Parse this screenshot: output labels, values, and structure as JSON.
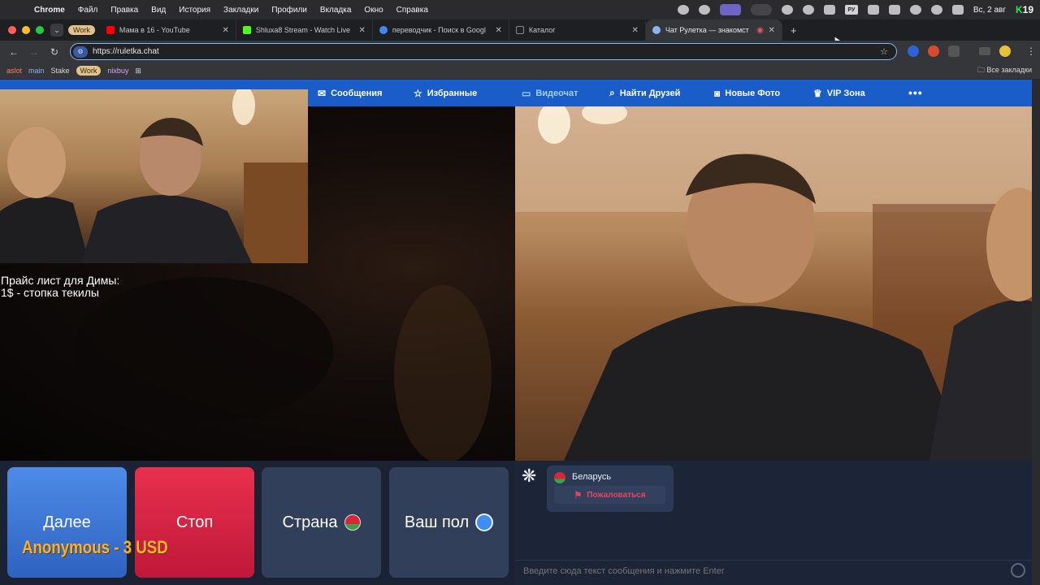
{
  "menubar": {
    "app": "Chrome",
    "items": [
      "Файл",
      "Правка",
      "Вид",
      "История",
      "Закладки",
      "Профили",
      "Вкладка",
      "Окно",
      "Справка"
    ],
    "lang": "РУ",
    "clock": "Вс, 2 авг",
    "badge": "K",
    "badge_num": "19"
  },
  "tabs": {
    "group_label": "Work",
    "items": [
      {
        "title": "Мама в 16 - YouTube",
        "icon": "youtube-icon",
        "color": "#ff0000"
      },
      {
        "title": "Shluxa8 Stream - Watch Live",
        "icon": "kick-icon",
        "color": "#53fc18"
      },
      {
        "title": "переводчик - Поиск в Googl",
        "icon": "google-icon",
        "color": "#4285f4"
      },
      {
        "title": "Каталог",
        "icon": "page-icon",
        "color": "#222222"
      },
      {
        "title": "Чат Рулетка — знакомст",
        "icon": "ruletka-icon",
        "color": "#8ab4f8"
      }
    ]
  },
  "address": {
    "url": "https://ruletka.chat"
  },
  "bookmarks": {
    "items": [
      {
        "label": "aslot",
        "style": "red"
      },
      {
        "label": "main",
        "style": "blue"
      },
      {
        "label": "Stake",
        "style": "plain"
      },
      {
        "label": "Work",
        "style": "work"
      },
      {
        "label": "nixbuy",
        "style": "pur"
      }
    ],
    "all_label": "Все закладки"
  },
  "site_nav": {
    "items": [
      {
        "label": "Сообщения",
        "icon": "envelope-icon",
        "icon_char": "✉"
      },
      {
        "label": "Избранные",
        "icon": "star-icon",
        "icon_char": "☆"
      },
      {
        "label": "Видеочат",
        "icon": "video-camera-icon",
        "icon_char": "▭"
      },
      {
        "label": "Найти Друзей",
        "icon": "search-icon",
        "icon_char": "⌕"
      },
      {
        "label": "Новые Фото",
        "icon": "camera-icon",
        "icon_char": "◙"
      },
      {
        "label": "VIP Зона",
        "icon": "crown-icon",
        "icon_char": "♛"
      }
    ],
    "more": "•••"
  },
  "overlay": {
    "line1": "Прайс лист для Димы:",
    "line2": "1$ - стопка текилы"
  },
  "controls": {
    "next": "Далее",
    "stop": "Стоп",
    "country": "Страна",
    "gender": "Ваш пол"
  },
  "donation": "Anonymous - 3 USD",
  "chat": {
    "country": "Беларусь",
    "report": "Пожаловаться",
    "input_placeholder": "Введите сюда текст сообщения и нажмите Enter"
  }
}
